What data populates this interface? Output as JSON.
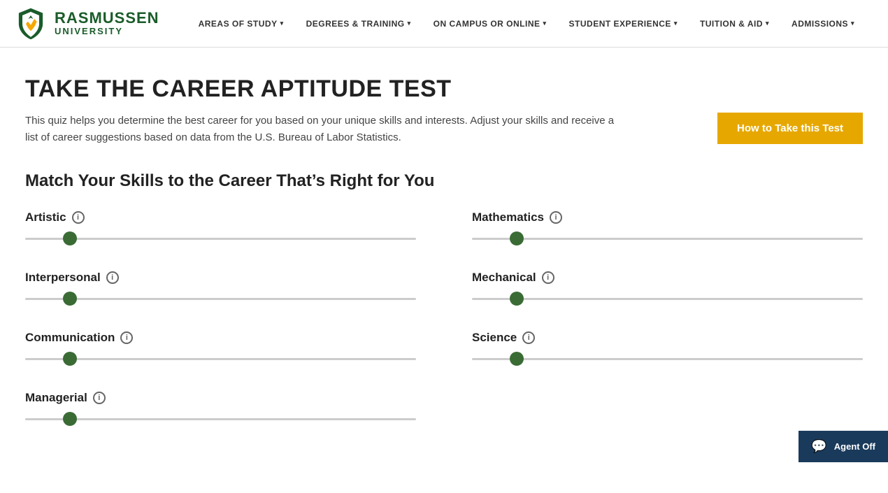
{
  "nav": {
    "logo": {
      "name": "RASMUSSEN",
      "sub": "UNIVERSITY"
    },
    "items": [
      {
        "label": "AREAS OF STUDY",
        "id": "areas-of-study"
      },
      {
        "label": "DEGREES & TRAINING",
        "id": "degrees-training"
      },
      {
        "label": "ON CAMPUS OR ONLINE",
        "id": "on-campus-online"
      },
      {
        "label": "STUDENT EXPERIENCE",
        "id": "student-experience"
      },
      {
        "label": "TUITION & AID",
        "id": "tuition-aid"
      },
      {
        "label": "ADMISSIONS",
        "id": "admissions"
      }
    ]
  },
  "page": {
    "title": "Take the CAREER APTITUDE TEST",
    "intro": "This quiz helps you determine the best career for you based on your unique skills and interests. Adjust your skills and receive a list of career suggestions based on data from the U.S. Bureau of Labor Statistics.",
    "how_to_btn": "How to Take this Test",
    "section_heading": "Match Your Skills to the Career That’s Right for You"
  },
  "skills": {
    "left": [
      {
        "label": "Artistic",
        "value": 1
      },
      {
        "label": "Interpersonal",
        "value": 1
      },
      {
        "label": "Communication",
        "value": 1
      },
      {
        "label": "Managerial",
        "value": 1
      }
    ],
    "right": [
      {
        "label": "Mathematics",
        "value": 1
      },
      {
        "label": "Mechanical",
        "value": 1
      },
      {
        "label": "Science",
        "value": 1
      }
    ]
  },
  "chat": {
    "label": "Agent Off"
  }
}
